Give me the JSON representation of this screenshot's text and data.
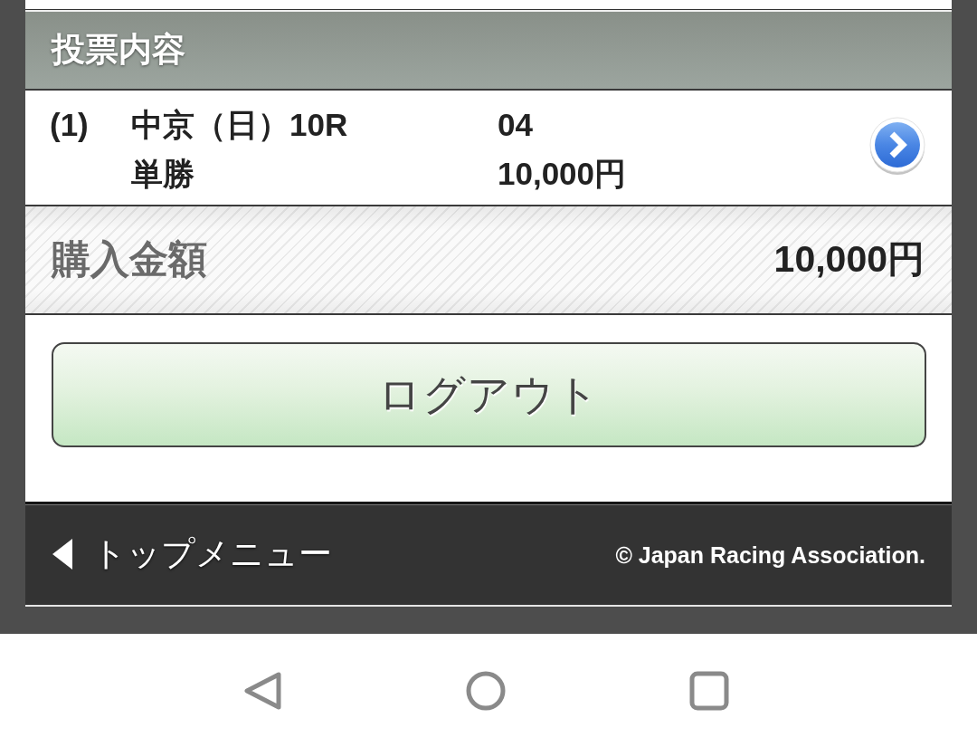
{
  "section_header": {
    "title": "投票内容"
  },
  "bets": [
    {
      "number": "(1)",
      "race": "中京（日）10R",
      "selection": "04",
      "bet_type": "単勝",
      "amount": "10,000円"
    }
  ],
  "total": {
    "label": "購入金額",
    "amount": "10,000円"
  },
  "logout_button": {
    "label": "ログアウト"
  },
  "footer": {
    "back_link": "トップメニュー",
    "copyright": "© Japan Racing Association."
  },
  "nav_bar": {
    "buttons": [
      {
        "kind": "back"
      },
      {
        "kind": "home"
      },
      {
        "kind": "recents"
      }
    ]
  }
}
